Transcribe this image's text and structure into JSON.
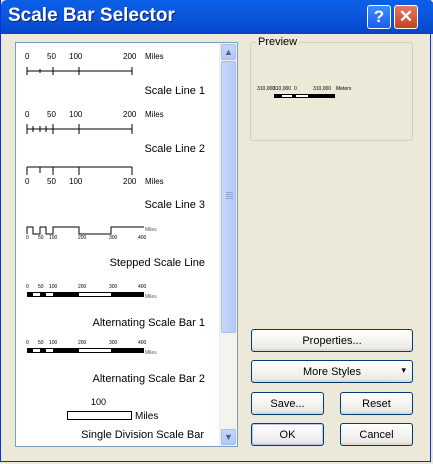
{
  "window": {
    "title": "Scale Bar Selector",
    "help_glyph": "?",
    "close_glyph": "✕"
  },
  "list": {
    "items": [
      {
        "label": "Scale Line 1",
        "ticks": [
          "0",
          "50",
          "100",
          "200"
        ],
        "units": "Miles"
      },
      {
        "label": "Scale Line 2",
        "ticks": [
          "0",
          "50",
          "100",
          "200"
        ],
        "units": "Miles"
      },
      {
        "label": "Scale Line 3",
        "ticks": [
          "0",
          "50",
          "100",
          "200"
        ],
        "units": "Miles"
      },
      {
        "label": "Stepped Scale Line",
        "ticks": [
          "0",
          "50",
          "100",
          "200",
          "300",
          "400"
        ],
        "units": "Miles"
      },
      {
        "label": "Alternating Scale Bar 1",
        "ticks": [
          "0",
          "50",
          "100",
          "200",
          "300",
          "400"
        ],
        "units": "Miles"
      },
      {
        "label": "Alternating Scale Bar 2",
        "ticks": [
          "0",
          "50",
          "100",
          "200",
          "300",
          "400"
        ],
        "units": "Miles"
      },
      {
        "label": "Single Division Scale Bar",
        "ticks": [
          "100"
        ],
        "units": "Miles"
      }
    ],
    "scroll_up": "▲",
    "scroll_down": "▼"
  },
  "preview": {
    "legend": "Preview",
    "text_left": "310,000",
    "text_mid": "310,000",
    "text_zero": "0",
    "text_right": "310,000",
    "text_units": "Meters"
  },
  "buttons": {
    "properties": "Properties...",
    "more_styles": "More Styles",
    "more_styles_arrow": "▾",
    "save": "Save...",
    "reset": "Reset",
    "ok": "OK",
    "cancel": "Cancel"
  }
}
